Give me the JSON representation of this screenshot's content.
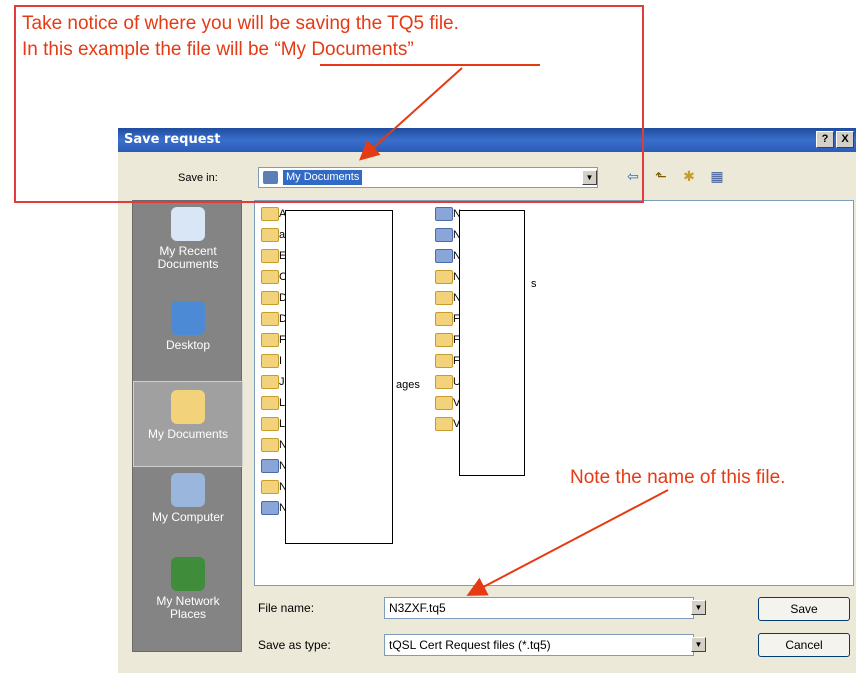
{
  "annotation": {
    "line1": "Take notice of where you will be saving the TQ5 file.",
    "line2_prefix": "In this example the file will be ",
    "line2_quote": "“My Documents”",
    "note": "Note the name of this file."
  },
  "dialog": {
    "title": "Save request",
    "help_btn": "?",
    "close_btn": "X",
    "save_in_label": "Save in:",
    "save_in_value": "My Documents",
    "places": [
      {
        "line1": "My Recent",
        "line2": "Documents",
        "icon": "recent-documents-icon"
      },
      {
        "line1": "Desktop",
        "line2": "",
        "icon": "desktop-icon"
      },
      {
        "line1": "My Documents",
        "line2": "",
        "icon": "my-documents-icon"
      },
      {
        "line1": "My Computer",
        "line2": "",
        "icon": "my-computer-icon"
      },
      {
        "line1": "My Network",
        "line2": "Places",
        "icon": "my-network-places-icon"
      }
    ],
    "file_fragments_left": [
      "A",
      "a",
      "E",
      "C",
      "D",
      "D",
      "F",
      "I",
      "J",
      "L",
      "L",
      "N",
      "N",
      "N",
      "N"
    ],
    "file_fragments_right": [
      "N",
      "N",
      "N",
      "N",
      "N",
      "F",
      "F",
      "F",
      "U",
      "V",
      "V"
    ],
    "fragment_s1": "s",
    "fragment_ages": "ages",
    "fragment_s2": "s",
    "file_name_label": "File name:",
    "file_name_value": "N3ZXF.tq5",
    "save_type_label": "Save as type:",
    "save_type_value": "tQSL Cert Request files (*.tq5)",
    "save_button": "Save",
    "cancel_button": "Cancel"
  }
}
